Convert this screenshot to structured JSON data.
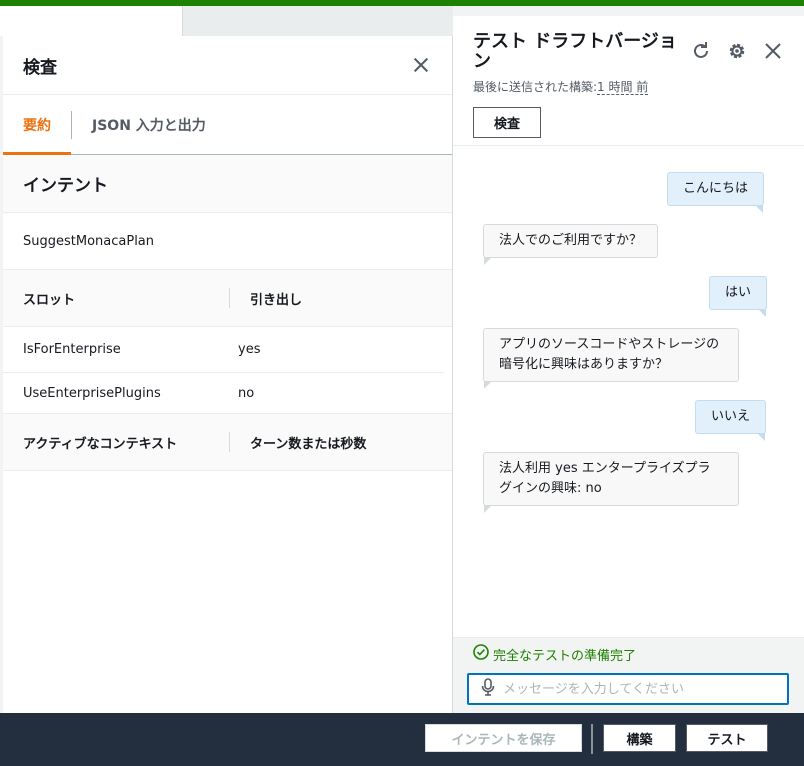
{
  "inspect": {
    "title": "検査",
    "tabs": [
      {
        "label": "要約",
        "active": true
      },
      {
        "label": "JSON 入力と出力",
        "active": false
      }
    ],
    "intent_heading": "インテント",
    "intent_name": "SuggestMonacaPlan",
    "slots_table": {
      "headers": [
        "スロット",
        "引き出し"
      ],
      "rows": [
        {
          "slot": "IsForEnterprise",
          "value": "yes"
        },
        {
          "slot": "UseEnterprisePlugins",
          "value": "no"
        }
      ]
    },
    "context_table": {
      "headers": [
        "アクティブなコンテキスト",
        "ターン数または秒数"
      ]
    }
  },
  "test": {
    "title": "テスト ドラフトバージョン",
    "subtitle_prefix": "最後に送信された構築:",
    "subtitle_time": "1 時間 前",
    "inspect_button": "検査",
    "icons": [
      "refresh-icon",
      "gear-icon",
      "close-icon"
    ],
    "messages": [
      {
        "from": "user",
        "text": "こんにちは"
      },
      {
        "from": "bot",
        "text": "法人でのご利用ですか？"
      },
      {
        "from": "user",
        "text": "はい"
      },
      {
        "from": "bot",
        "text": "アプリのソースコードやストレージの暗号化に興味はありますか？"
      },
      {
        "from": "user",
        "text": "いいえ"
      },
      {
        "from": "bot",
        "text": "法人利用 yes エンタープライズプラグインの興味: no"
      }
    ],
    "status": "完全なテストの準備完了",
    "input_placeholder": "メッセージを入力してください",
    "status_color": "#1d8102"
  },
  "bottombar": {
    "save_intent": "インテントを保存",
    "build": "構築",
    "test": "テスト"
  }
}
